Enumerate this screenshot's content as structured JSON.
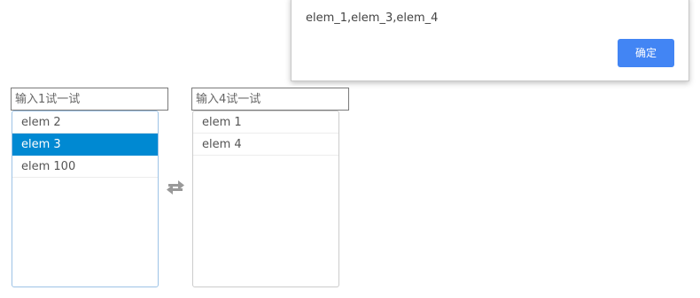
{
  "alert": {
    "message": "elem_1,elem_3,elem_4",
    "ok_label": "确定"
  },
  "left_panel": {
    "filter_placeholder": "输入1试一试",
    "items": [
      {
        "label": "elem 2",
        "selected": false
      },
      {
        "label": "elem 3",
        "selected": true
      },
      {
        "label": "elem 100",
        "selected": false
      }
    ]
  },
  "right_panel": {
    "filter_placeholder": "输入4试一试",
    "items": [
      {
        "label": "elem 1",
        "selected": false
      },
      {
        "label": "elem 4",
        "selected": false
      }
    ]
  },
  "transfer": {
    "icon": "exchange-icon"
  },
  "colors": {
    "ok_button": "#4285f4",
    "selected_item": "#0089d2",
    "left_list_border": "#9dc3e6",
    "icon": "#999999"
  }
}
